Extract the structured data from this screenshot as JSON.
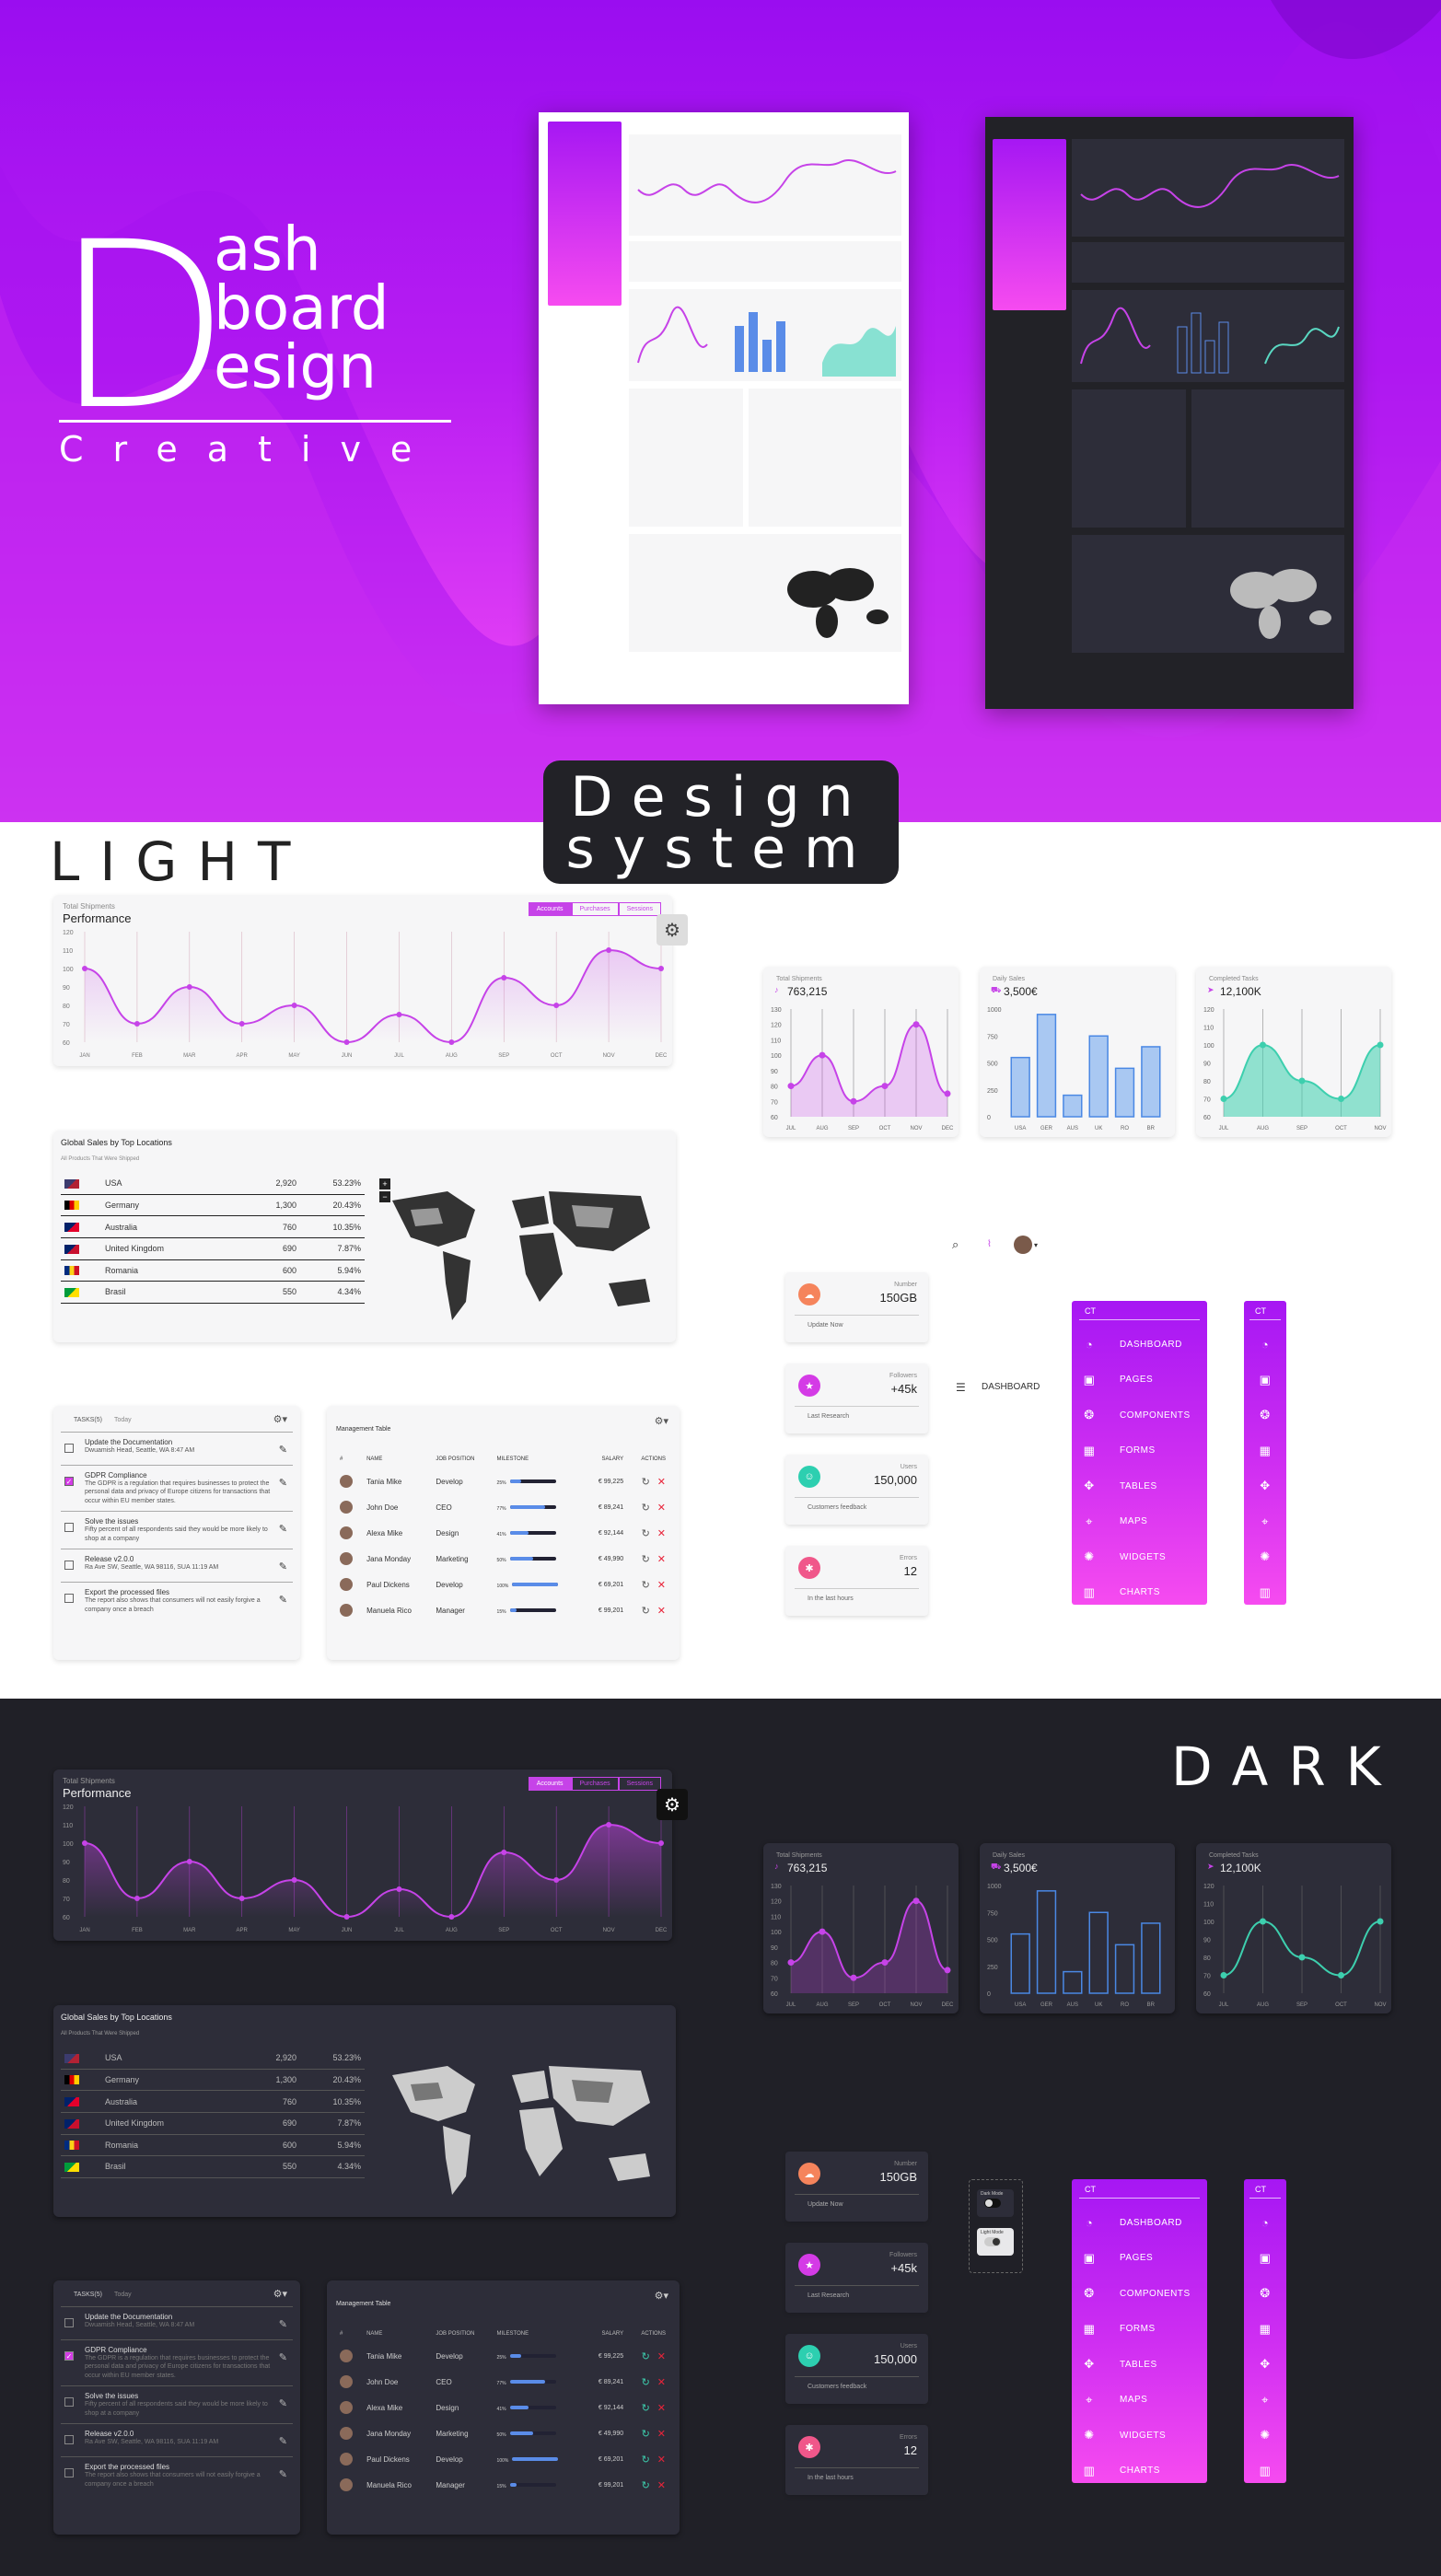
{
  "hero": {
    "logo_big": "D",
    "logo_w1": "ash",
    "logo_w2": "board",
    "logo_w3": "esign",
    "logo_sub": "Creative"
  },
  "design_system": {
    "line1": "Design",
    "line2": "system"
  },
  "section_light": "LIGHT",
  "section_dark": "DARK",
  "performance": {
    "label": "Total Shipments",
    "title": "Performance",
    "tabs": [
      "Accounts",
      "Purchases",
      "Sessions"
    ],
    "chart_data": {
      "type": "line",
      "categories": [
        "JAN",
        "FEB",
        "MAR",
        "APR",
        "MAY",
        "JUN",
        "JUL",
        "AUG",
        "SEP",
        "OCT",
        "NOV",
        "DEC"
      ],
      "values": [
        100,
        70,
        90,
        70,
        80,
        60,
        75,
        60,
        95,
        80,
        110,
        100
      ],
      "yticks": [
        "120",
        "110",
        "100",
        "90",
        "80",
        "70",
        "60"
      ],
      "ylim": [
        60,
        120
      ]
    }
  },
  "small_charts": [
    {
      "label": "Total Shipments",
      "value": "763,215",
      "icon": "bell-icon",
      "type": "line",
      "categories": [
        "JUL",
        "AUG",
        "SEP",
        "OCT",
        "NOV",
        "DEC"
      ],
      "values": [
        80,
        100,
        70,
        80,
        120,
        75
      ],
      "yticks": [
        "130",
        "120",
        "110",
        "100",
        "90",
        "80",
        "70",
        "60"
      ],
      "ylim": [
        60,
        130
      ]
    },
    {
      "label": "Daily Sales",
      "value": "3,500€",
      "icon": "delivery-icon",
      "type": "bar",
      "categories": [
        "USA",
        "GER",
        "AUS",
        "UK",
        "RO",
        "BR"
      ],
      "values": [
        550,
        950,
        200,
        750,
        450,
        650
      ],
      "yticks": [
        "1000",
        "750",
        "500",
        "250",
        "0"
      ],
      "ylim": [
        0,
        1000
      ]
    },
    {
      "label": "Completed Tasks",
      "value": "12,100K",
      "icon": "send-icon",
      "type": "area",
      "categories": [
        "JUL",
        "AUG",
        "SEP",
        "OCT",
        "NOV"
      ],
      "values": [
        70,
        100,
        80,
        70,
        100
      ],
      "yticks": [
        "120",
        "110",
        "100",
        "90",
        "80",
        "70",
        "60"
      ],
      "ylim": [
        60,
        120
      ]
    }
  ],
  "global_sales": {
    "title": "Global Sales by Top Locations",
    "subtitle": "All Products That Were Shipped",
    "rows": [
      {
        "country": "USA",
        "sales": "2,920",
        "pct": "53.23%",
        "flag": [
          "#3c3b6e",
          "#b22234"
        ]
      },
      {
        "country": "Germany",
        "sales": "1,300",
        "pct": "20.43%",
        "flag": [
          "#000",
          "#dd0000",
          "#ffce00"
        ]
      },
      {
        "country": "Australia",
        "sales": "760",
        "pct": "10.35%",
        "flag": [
          "#012169",
          "#e4002b"
        ]
      },
      {
        "country": "United Kingdom",
        "sales": "690",
        "pct": "7.87%",
        "flag": [
          "#012169",
          "#c8102e"
        ]
      },
      {
        "country": "Romania",
        "sales": "600",
        "pct": "5.94%",
        "flag": [
          "#002b7f",
          "#fcd116",
          "#ce1126"
        ]
      },
      {
        "country": "Brasil",
        "sales": "550",
        "pct": "4.34%",
        "flag": [
          "#009c3b",
          "#ffdf00"
        ]
      }
    ]
  },
  "tasks": {
    "tabs": [
      "TASKS(5)",
      "Today"
    ],
    "items": [
      {
        "title": "Update the Documentation",
        "desc": "Dwuamish Head, Seattle, WA 8:47 AM",
        "checked": false
      },
      {
        "title": "GDPR Compliance",
        "desc": "The GDPR is a regulation that requires businesses to protect the personal data and privacy of Europe citizens for transactions that occur within EU member states.",
        "checked": true
      },
      {
        "title": "Solve the issues",
        "desc": "Fifty percent of all respondents said they would be more likely to shop at a company",
        "checked": false
      },
      {
        "title": "Release v2.0.0",
        "desc": "Ra Ave SW, Seattle, WA 98116, SUA 11:19 AM",
        "checked": false
      },
      {
        "title": "Export the processed files",
        "desc": "The report also shows that consumers will not easily forgive a company once a breach",
        "checked": false
      }
    ]
  },
  "management": {
    "title": "Management Table",
    "headers": [
      "#",
      "NAME",
      "JOB POSITION",
      "MILESTONE",
      "SALARY",
      "ACTIONS"
    ],
    "rows": [
      {
        "name": "Tania Mike",
        "job": "Develop",
        "pct": "25%",
        "fill": 0.25,
        "salary": "€ 99,225"
      },
      {
        "name": "John Doe",
        "job": "CEO",
        "pct": "77%",
        "fill": 0.77,
        "salary": "€ 89,241"
      },
      {
        "name": "Alexa Mike",
        "job": "Design",
        "pct": "41%",
        "fill": 0.41,
        "salary": "€ 92,144"
      },
      {
        "name": "Jana Monday",
        "job": "Marketing",
        "pct": "50%",
        "fill": 0.5,
        "salary": "€ 49,990"
      },
      {
        "name": "Paul Dickens",
        "job": "Develop",
        "pct": "100%",
        "fill": 1.0,
        "salary": "€ 69,201"
      },
      {
        "name": "Manuela Rico",
        "job": "Manager",
        "pct": "15%",
        "fill": 0.15,
        "salary": "€ 99,201"
      }
    ]
  },
  "stats": [
    {
      "name": "Number",
      "value": "150GB",
      "footer": "Update Now",
      "color": "#f5845c",
      "icon": "database-icon"
    },
    {
      "name": "Followers",
      "value": "+45k",
      "footer": "Last Research",
      "color": "#d43be6",
      "icon": "star-icon"
    },
    {
      "name": "Users",
      "value": "150,000",
      "footer": "Customers feedback",
      "color": "#2dcfb0",
      "icon": "user-icon"
    },
    {
      "name": "Errors",
      "value": "12",
      "footer": "In the last hours",
      "color": "#f0578a",
      "icon": "bug-icon"
    }
  ],
  "topbar": {
    "dashboard_label": "DASHBOARD"
  },
  "sidebar": {
    "brand": "CT",
    "items": [
      {
        "label": "DASHBOARD",
        "icon": "dashboard-icon",
        "glyph": "◔"
      },
      {
        "label": "PAGES",
        "icon": "image-icon",
        "glyph": "▣"
      },
      {
        "label": "COMPONENTS",
        "icon": "components-icon",
        "glyph": "❂"
      },
      {
        "label": "FORMS",
        "icon": "calendar-icon",
        "glyph": "▦"
      },
      {
        "label": "TABLES",
        "icon": "puzzle-icon",
        "glyph": "✥"
      },
      {
        "label": "MAPS",
        "icon": "pin-icon",
        "glyph": "⌖"
      },
      {
        "label": "WIDGETS",
        "icon": "widgets-icon",
        "glyph": "✺"
      },
      {
        "label": "CHARTS",
        "icon": "chart-icon",
        "glyph": "▥"
      }
    ]
  },
  "theme_toggle": {
    "light": "Light Mode",
    "dark": "Dark Mode"
  }
}
